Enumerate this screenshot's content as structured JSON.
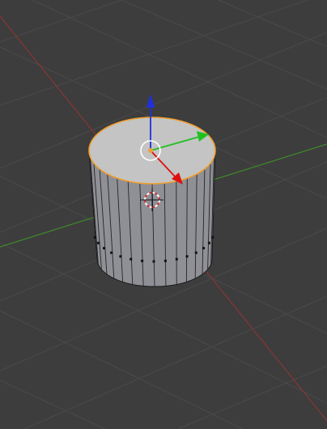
{
  "viewport": {
    "background_color": "#3d3d3d",
    "grid_line_color": "#4a4a4a",
    "x_axis_color": "#8a3535",
    "y_axis_color": "#3f8a2a",
    "grid_visible": true
  },
  "object": {
    "type": "cylinder",
    "state": "selected",
    "edit_mode": true,
    "vertex_count_per_ring": 32,
    "selected_face": "top",
    "face_color": "#c2c2c2",
    "side_color": "#8f8f96",
    "edge_color": "#1a1a1a",
    "selection_outline_color": "#f0a030",
    "loop_cut_marker_color": "#111111"
  },
  "manipulator": {
    "mode": "translate",
    "x_handle_color": "#dd1010",
    "y_handle_color": "#20c020",
    "z_handle_color": "#2030e0",
    "center_ring_color": "#ffffff",
    "pivot_color": "#f0a030"
  },
  "cursor_3d": {
    "icon": "3d-cursor-icon",
    "ring_colors": [
      "#ffffff",
      "#d03030"
    ]
  }
}
